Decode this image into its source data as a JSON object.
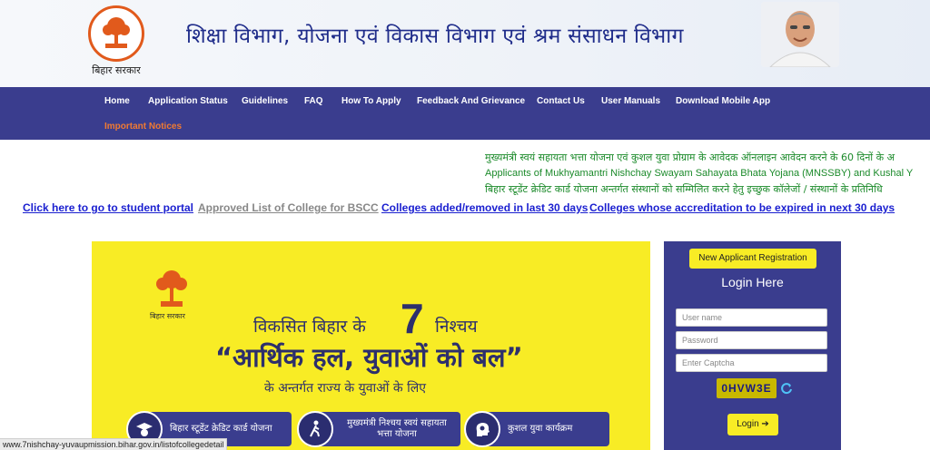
{
  "header": {
    "logo_caption": "बिहार सरकार",
    "title": "शिक्षा विभाग, योजना एवं विकास विभाग एवं श्रम संसाधन विभाग"
  },
  "nav": {
    "items": [
      "Home",
      "Application Status",
      "Guidelines",
      "FAQ",
      "How To Apply",
      "Feedback And Grievance",
      "Contact Us",
      "User Manuals",
      "Download Mobile App"
    ],
    "important": "Important Notices"
  },
  "marquee": {
    "line1": "मुख्यमंत्री स्वयं सहायता भत्ता योजना एवं कुशल युवा प्रोग्राम के आवेदक ऑनलाइन आवेदन करने के 60 दिनों के अ",
    "line2": "Applicants of Mukhyamantri Nishchay Swayam Sahayata Bhata Yojana (MNSSBY) and Kushal Y",
    "line3": "बिहार स्टूडेंट क्रेडिट कार्ड योजना अन्तर्गत संस्थानों को सम्मिलित करने हेतु इच्छुक कॉलेजों / संस्थानों के प्रतिनिधि"
  },
  "links": {
    "student_portal": "Click here to go to student portal",
    "approved_list": "Approved List of College for BSCC",
    "colleges_added": "Colleges added/removed in last 30 days",
    "colleges_accreditation": "Colleges whose accreditation to be expired in next 30 days"
  },
  "banner": {
    "logo_caption": "बिहार सरकार",
    "line1a": "विकसित बिहार के",
    "seven": "7",
    "line1b": "निश्चय",
    "line2": "“आर्थिक हल, युवाओं को बल”",
    "line3": "के अन्तर्गत राज्य के युवाओं के लिए",
    "cards": [
      "बिहार स्टूडेंट क्रेडिट कार्ड योजना",
      "मुख्यमंत्री निश्चय स्वयं सहायता भत्ता योजना",
      "कुशल युवा कार्यक्रम"
    ]
  },
  "login": {
    "register_label": "New Applicant Registration",
    "title": "Login Here",
    "username_placeholder": "User name",
    "password_placeholder": "Password",
    "captcha_placeholder": "Enter Captcha",
    "captcha_text": "0HVW3E",
    "login_label": "Login ➔"
  },
  "statusbar": {
    "url": "www.7nishchay-yuvaupmission.bihar.gov.in/listofcollegedetail"
  },
  "colors": {
    "nav_bg": "#3a3d8e",
    "banner_yellow": "#f8ec25",
    "link_blue": "#1a1fd0",
    "marquee_green": "#1b8a2a",
    "notice_orange": "#f07a32"
  }
}
